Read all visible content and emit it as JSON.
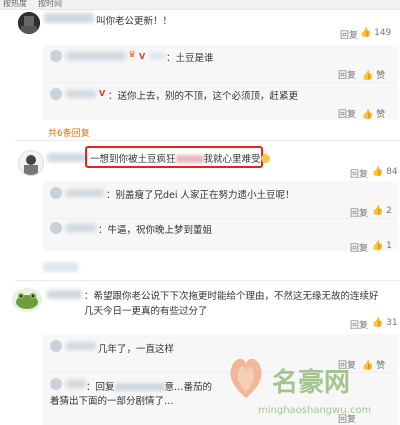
{
  "tabs": [
    "按热度",
    "按时间"
  ],
  "comments": [
    {
      "text": "叫你老公更新！！",
      "reply_label": "回复",
      "likes": "149",
      "replies": [
        {
          "text": "：土豆是谁",
          "reply_label": "回复",
          "like_label": "赞"
        },
        {
          "text": "：送你上去，别的不顶，这个必须顶，赶紧更",
          "reply_label": "回复",
          "like_label": "赞"
        }
      ],
      "more_replies": "共6条回复"
    },
    {
      "text_before": "一想到你被土豆疯狂",
      "text_after": "我就心里难受",
      "reply_label": "回复",
      "likes": "84",
      "replies": [
        {
          "text": "：别盖瘦了兄dei  人家正在努力遗小土豆呢！",
          "reply_label": "回复",
          "likes": "2"
        },
        {
          "text": "：牛逼，祝你晚上梦到董姐",
          "reply_label": "回复",
          "likes": "1"
        }
      ]
    },
    {
      "text": "：希望跟你老公说下下次拖更时能给个理由，不然这无缘无故的连续好几天今日一更真的有些过分了",
      "reply_label": "回复",
      "likes": "31",
      "replies": [
        {
          "text": "几年了，一直这样",
          "reply_label": "回复",
          "like_label": "赞"
        },
        {
          "text_before": "：回复",
          "text_mid": "意…番茄的",
          "text_line2": "着猜出下面的一部分剧情了…",
          "reply_label": "回复"
        }
      ]
    }
  ],
  "watermark": {
    "title": "名豪网",
    "url": "minghaoshangwu.com"
  },
  "colors": {
    "highlight": "#e8231a",
    "link": "#e07000"
  }
}
